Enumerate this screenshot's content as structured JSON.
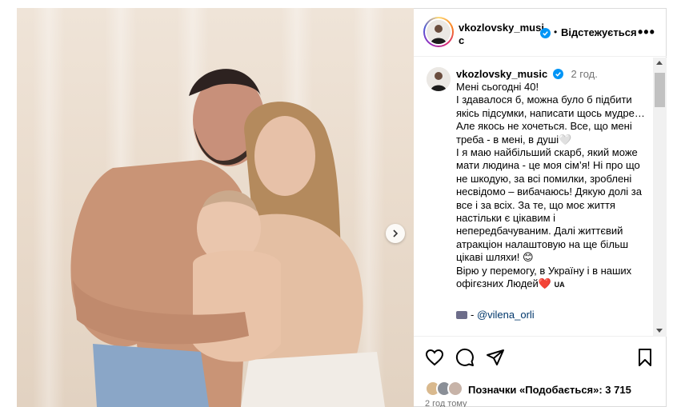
{
  "post": {
    "username_header": "vkozlovsky_music",
    "follow_status": "Відстежується",
    "dot": "•",
    "more": "•••"
  },
  "caption": {
    "username": "vkozlovsky_music",
    "time": "2 год.",
    "text": "Мені сьогодні 40!\nІ здавалося б, можна було б підбити якісь підсумки, написати щось мудре… Але якось не хочеться. Все, що мені треба - в мені, в душі🤍\nІ я маю найбільший скарб, який може мати людина - це моя сім’я! Ні про що не шкодую, за всі помилки, зроблені несвідомо – вибачаюсь! Дякую долі за все і за всіх. За те, що моє життя настільки є цікавим і непередбачуваним. Далі життєвий атракціон налаштовую на ще більш цікаві шляхи! 😊\nВірю у перемогу, в Україну і в наших офігєзних Людей❤️",
    "flag_text": "UA",
    "tag_prefix": "- ",
    "mention": "@vilena_orli"
  },
  "likes": {
    "text": "Позначки «Подобається»: 3 715"
  },
  "posted": "2 год тому",
  "icons": [
    "heart-icon",
    "comment-icon",
    "share-icon",
    "bookmark-icon",
    "verified-icon",
    "chevron-right-icon",
    "more-icon",
    "camera-icon"
  ],
  "colors": {
    "verified": "#0095f6",
    "mention": "#00376b",
    "muted": "#737373",
    "border": "#dbdbdb"
  }
}
